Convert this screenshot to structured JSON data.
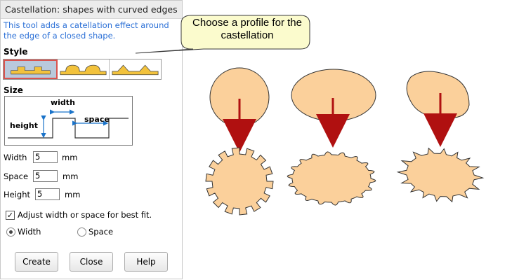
{
  "window": {
    "title": "Castellation: shapes with curved edges"
  },
  "description": "This tool adds a catellation effect around the edge of a closed shape.",
  "style_section": {
    "label": "Style",
    "options": [
      "rectangular-profile",
      "rounded-profile",
      "pointed-profile"
    ],
    "selected": 0
  },
  "size_section": {
    "label": "Size",
    "diagram": {
      "width_label": "width",
      "height_label": "height",
      "space_label": "space"
    },
    "fields": [
      {
        "label": "Width",
        "value": "5",
        "unit": "mm"
      },
      {
        "label": "Space",
        "value": "5",
        "unit": "mm"
      },
      {
        "label": "Height",
        "value": "5",
        "unit": "mm"
      }
    ]
  },
  "adjust": {
    "label": "Adjust width or space for best fit.",
    "checked": true,
    "mark": "✓"
  },
  "fit_mode": {
    "options": [
      {
        "label": "Width",
        "selected": true
      },
      {
        "label": "Space",
        "selected": false
      }
    ]
  },
  "buttons": {
    "create": "Create",
    "close": "Close",
    "help": "Help"
  },
  "callout": {
    "text": "Choose a profile for the castellation"
  },
  "colors": {
    "shape_fill": "#fbd09b",
    "arrow": "#b01010",
    "callout_fill": "#fbfbcd",
    "profile_fill": "#f2c23c",
    "link_text": "#2a6fd6"
  }
}
